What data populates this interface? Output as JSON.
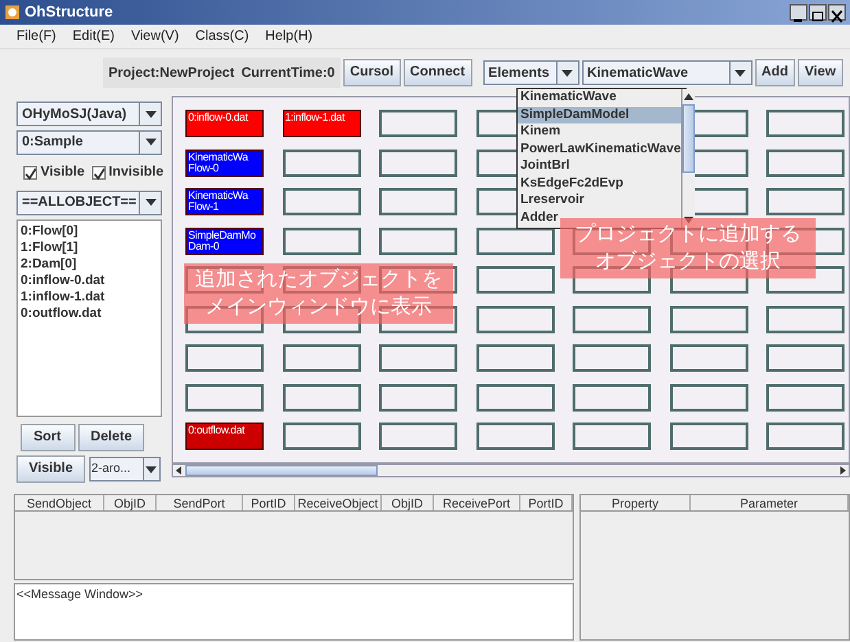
{
  "window": {
    "title": "OhStructure"
  },
  "menu": [
    {
      "label": "File(F)"
    },
    {
      "label": "Edit(E)"
    },
    {
      "label": "View(V)"
    },
    {
      "label": "Class(C)"
    },
    {
      "label": "Help(H)"
    }
  ],
  "toolbar": {
    "project": "Project:NewProject",
    "current_time": "CurrentTime:0",
    "mode_buttons": [
      "Cursol",
      "Connect"
    ],
    "category_combo": "Elements",
    "class_combo": "KinematicWave",
    "action_buttons": [
      "Add",
      "View"
    ]
  },
  "class_list": [
    {
      "label": "KinematicWave",
      "selected": false
    },
    {
      "label": "SimpleDamModel",
      "selected": true
    },
    {
      "label": "Kinem",
      "selected": false
    },
    {
      "label": "PowerLawKinematicWave",
      "selected": false
    },
    {
      "label": "JointBrl",
      "selected": false
    },
    {
      "label": "KsEdgeFc2dEvp",
      "selected": false
    },
    {
      "label": "Lreservoir",
      "selected": false
    },
    {
      "label": "Adder",
      "selected": false
    }
  ],
  "left_panel": {
    "engine_combo": "OHyMoSJ(Java)",
    "project_combo": "0:Sample",
    "checkboxes": [
      {
        "label": "Visible",
        "checked": true
      },
      {
        "label": "Invisible",
        "checked": true
      }
    ],
    "filter_combo": "==ALLOBJECT==",
    "objects": [
      "0:Flow[0]",
      "1:Flow[1]",
      "2:Dam[0]",
      "0:inflow-0.dat",
      "1:inflow-1.dat",
      "0:outflow.dat"
    ],
    "list_buttons": [
      "Sort",
      "Delete"
    ],
    "visible_button": "Visible",
    "arrow_combo": "2-aro..."
  },
  "grid": {
    "rows": [
      {
        "cells": [
          {
            "kind": "object",
            "label": "0:inflow-0.dat",
            "color": "#ff0000"
          },
          {
            "kind": "object",
            "label": "1:inflow-1.dat",
            "color": "#ff0000"
          },
          {
            "kind": "empty"
          },
          {
            "kind": "empty"
          },
          {
            "kind": "covered"
          },
          {
            "kind": "empty"
          },
          {
            "kind": "empty"
          }
        ]
      },
      {
        "cells": [
          {
            "kind": "object",
            "label": "KinematicWa Flow-0",
            "color": "#0000ff"
          },
          {
            "kind": "empty"
          },
          {
            "kind": "empty"
          },
          {
            "kind": "empty"
          },
          {
            "kind": "covered"
          },
          {
            "kind": "empty"
          },
          {
            "kind": "empty"
          }
        ]
      },
      {
        "cells": [
          {
            "kind": "object",
            "label": "KinematicWa Flow-1",
            "color": "#0000ff"
          },
          {
            "kind": "empty"
          },
          {
            "kind": "empty"
          },
          {
            "kind": "empty"
          },
          {
            "kind": "covered"
          },
          {
            "kind": "empty"
          },
          {
            "kind": "empty"
          }
        ]
      },
      {
        "cells": [
          {
            "kind": "object",
            "label": "SimpleDamMo Dam-0",
            "color": "#0000ff"
          },
          {
            "kind": "empty"
          },
          {
            "kind": "empty"
          },
          {
            "kind": "empty"
          },
          {
            "kind": "empty"
          },
          {
            "kind": "empty"
          },
          {
            "kind": "empty"
          }
        ]
      },
      {
        "cells": [
          {
            "kind": "empty"
          },
          {
            "kind": "empty"
          },
          {
            "kind": "empty"
          },
          {
            "kind": "empty"
          },
          {
            "kind": "empty"
          },
          {
            "kind": "empty"
          },
          {
            "kind": "empty"
          }
        ]
      },
      {
        "cells": [
          {
            "kind": "empty"
          },
          {
            "kind": "empty"
          },
          {
            "kind": "empty"
          },
          {
            "kind": "empty"
          },
          {
            "kind": "empty"
          },
          {
            "kind": "empty"
          },
          {
            "kind": "empty"
          }
        ]
      },
      {
        "cells": [
          {
            "kind": "empty"
          },
          {
            "kind": "empty"
          },
          {
            "kind": "empty"
          },
          {
            "kind": "empty"
          },
          {
            "kind": "empty"
          },
          {
            "kind": "empty"
          },
          {
            "kind": "empty"
          }
        ]
      },
      {
        "cells": [
          {
            "kind": "empty"
          },
          {
            "kind": "empty"
          },
          {
            "kind": "empty"
          },
          {
            "kind": "empty"
          },
          {
            "kind": "empty"
          },
          {
            "kind": "empty"
          },
          {
            "kind": "empty"
          }
        ]
      },
      {
        "cells": [
          {
            "kind": "object",
            "label": "0:outflow.dat",
            "color": "#cc0000"
          },
          {
            "kind": "empty"
          },
          {
            "kind": "empty"
          },
          {
            "kind": "empty"
          },
          {
            "kind": "empty"
          },
          {
            "kind": "empty"
          },
          {
            "kind": "empty"
          }
        ]
      }
    ]
  },
  "annotations": [
    {
      "lines": [
        "追加されたオブジェクトを",
        "メインウィンドウに表示"
      ]
    },
    {
      "lines": [
        "プロジェクトに追加する",
        "オブジェクトの選択"
      ]
    }
  ],
  "connection_table": {
    "columns": [
      "SendObject",
      "ObjID",
      "SendPort",
      "PortID",
      "ReceiveObject",
      "ObjID",
      "ReceivePort",
      "PortID"
    ]
  },
  "message_window": {
    "text": "<<Message Window>>"
  },
  "property_table": {
    "columns": [
      "Property",
      "Parameter"
    ]
  }
}
